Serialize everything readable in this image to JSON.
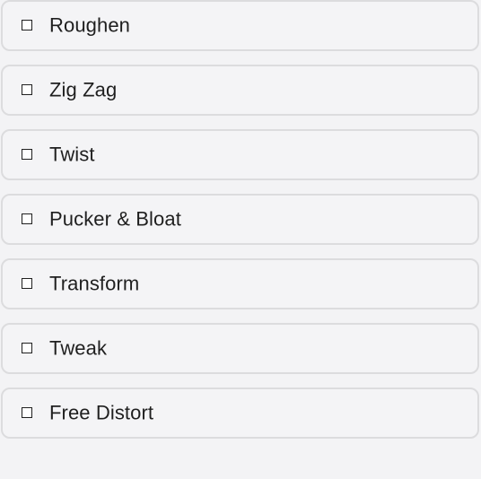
{
  "effects": {
    "items": [
      {
        "label": "Roughen",
        "checked": false
      },
      {
        "label": "Zig Zag",
        "checked": false
      },
      {
        "label": "Twist",
        "checked": false
      },
      {
        "label": "Pucker & Bloat",
        "checked": false
      },
      {
        "label": "Transform",
        "checked": false
      },
      {
        "label": "Tweak",
        "checked": false
      },
      {
        "label": "Free Distort",
        "checked": false
      }
    ]
  },
  "icons": {
    "checkbox": "checkbox-unchecked-icon"
  },
  "colors": {
    "background": "#f3f3f5",
    "row_background": "#f4f4f6",
    "row_border": "#dcdcde",
    "text": "#1f1f1f"
  }
}
